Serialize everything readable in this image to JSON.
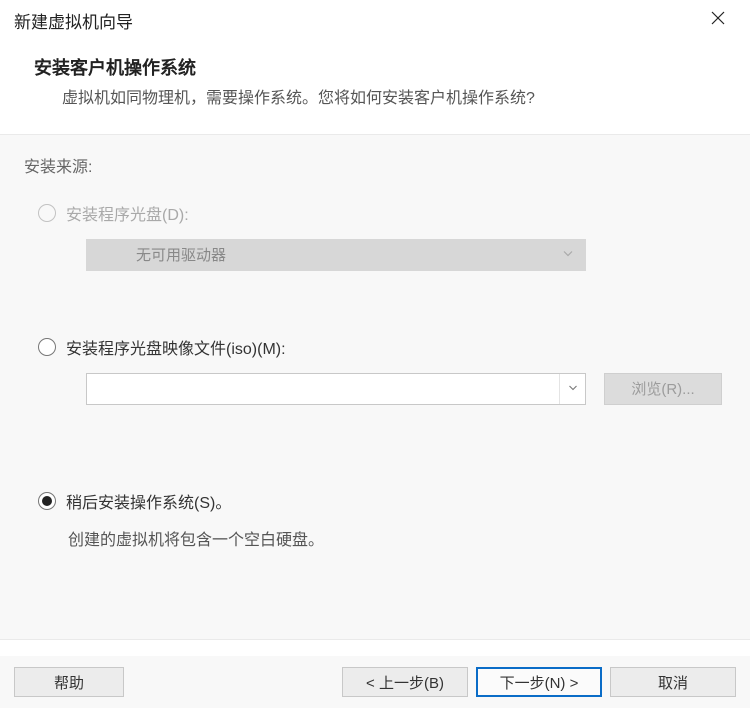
{
  "titlebar": {
    "title": "新建虚拟机向导"
  },
  "header": {
    "title": "安装客户机操作系统",
    "subtitle": "虚拟机如同物理机，需要操作系统。您将如何安装客户机操作系统?"
  },
  "section_label": "安装来源:",
  "options": {
    "disc": {
      "label": "安装程序光盘(D):",
      "dropdown_value": "无可用驱动器"
    },
    "iso": {
      "label": "安装程序光盘映像文件(iso)(M):",
      "browse": "浏览(R)..."
    },
    "later": {
      "label": "稍后安装操作系统(S)。",
      "description": "创建的虚拟机将包含一个空白硬盘。"
    }
  },
  "footer": {
    "help": "帮助",
    "back": "< 上一步(B)",
    "next": "下一步(N) >",
    "cancel": "取消"
  }
}
